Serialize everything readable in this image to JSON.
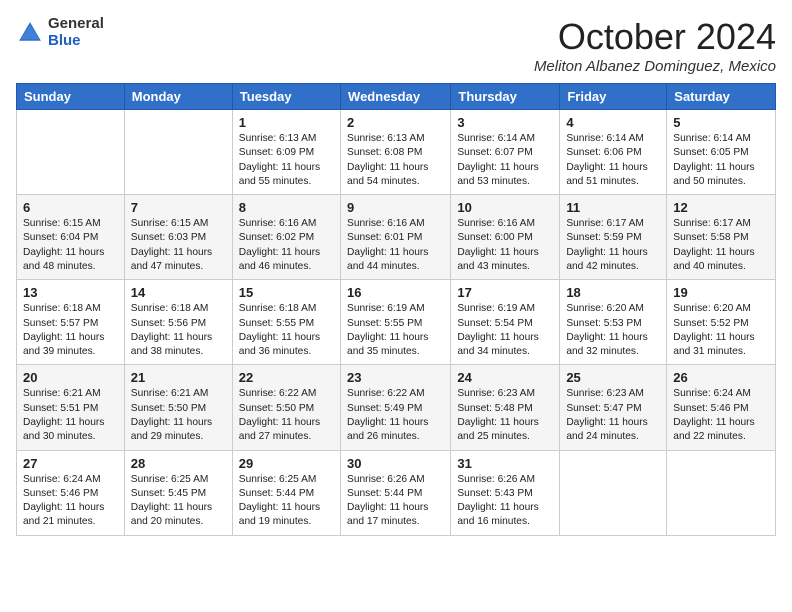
{
  "header": {
    "logo": {
      "general": "General",
      "blue": "Blue"
    },
    "title": "October 2024",
    "location": "Meliton Albanez Dominguez, Mexico"
  },
  "days_of_week": [
    "Sunday",
    "Monday",
    "Tuesday",
    "Wednesday",
    "Thursday",
    "Friday",
    "Saturday"
  ],
  "weeks": [
    [
      null,
      null,
      {
        "day": 1,
        "sunrise": "Sunrise: 6:13 AM",
        "sunset": "Sunset: 6:09 PM",
        "daylight": "Daylight: 11 hours and 55 minutes."
      },
      {
        "day": 2,
        "sunrise": "Sunrise: 6:13 AM",
        "sunset": "Sunset: 6:08 PM",
        "daylight": "Daylight: 11 hours and 54 minutes."
      },
      {
        "day": 3,
        "sunrise": "Sunrise: 6:14 AM",
        "sunset": "Sunset: 6:07 PM",
        "daylight": "Daylight: 11 hours and 53 minutes."
      },
      {
        "day": 4,
        "sunrise": "Sunrise: 6:14 AM",
        "sunset": "Sunset: 6:06 PM",
        "daylight": "Daylight: 11 hours and 51 minutes."
      },
      {
        "day": 5,
        "sunrise": "Sunrise: 6:14 AM",
        "sunset": "Sunset: 6:05 PM",
        "daylight": "Daylight: 11 hours and 50 minutes."
      }
    ],
    [
      {
        "day": 6,
        "sunrise": "Sunrise: 6:15 AM",
        "sunset": "Sunset: 6:04 PM",
        "daylight": "Daylight: 11 hours and 48 minutes."
      },
      {
        "day": 7,
        "sunrise": "Sunrise: 6:15 AM",
        "sunset": "Sunset: 6:03 PM",
        "daylight": "Daylight: 11 hours and 47 minutes."
      },
      {
        "day": 8,
        "sunrise": "Sunrise: 6:16 AM",
        "sunset": "Sunset: 6:02 PM",
        "daylight": "Daylight: 11 hours and 46 minutes."
      },
      {
        "day": 9,
        "sunrise": "Sunrise: 6:16 AM",
        "sunset": "Sunset: 6:01 PM",
        "daylight": "Daylight: 11 hours and 44 minutes."
      },
      {
        "day": 10,
        "sunrise": "Sunrise: 6:16 AM",
        "sunset": "Sunset: 6:00 PM",
        "daylight": "Daylight: 11 hours and 43 minutes."
      },
      {
        "day": 11,
        "sunrise": "Sunrise: 6:17 AM",
        "sunset": "Sunset: 5:59 PM",
        "daylight": "Daylight: 11 hours and 42 minutes."
      },
      {
        "day": 12,
        "sunrise": "Sunrise: 6:17 AM",
        "sunset": "Sunset: 5:58 PM",
        "daylight": "Daylight: 11 hours and 40 minutes."
      }
    ],
    [
      {
        "day": 13,
        "sunrise": "Sunrise: 6:18 AM",
        "sunset": "Sunset: 5:57 PM",
        "daylight": "Daylight: 11 hours and 39 minutes."
      },
      {
        "day": 14,
        "sunrise": "Sunrise: 6:18 AM",
        "sunset": "Sunset: 5:56 PM",
        "daylight": "Daylight: 11 hours and 38 minutes."
      },
      {
        "day": 15,
        "sunrise": "Sunrise: 6:18 AM",
        "sunset": "Sunset: 5:55 PM",
        "daylight": "Daylight: 11 hours and 36 minutes."
      },
      {
        "day": 16,
        "sunrise": "Sunrise: 6:19 AM",
        "sunset": "Sunset: 5:55 PM",
        "daylight": "Daylight: 11 hours and 35 minutes."
      },
      {
        "day": 17,
        "sunrise": "Sunrise: 6:19 AM",
        "sunset": "Sunset: 5:54 PM",
        "daylight": "Daylight: 11 hours and 34 minutes."
      },
      {
        "day": 18,
        "sunrise": "Sunrise: 6:20 AM",
        "sunset": "Sunset: 5:53 PM",
        "daylight": "Daylight: 11 hours and 32 minutes."
      },
      {
        "day": 19,
        "sunrise": "Sunrise: 6:20 AM",
        "sunset": "Sunset: 5:52 PM",
        "daylight": "Daylight: 11 hours and 31 minutes."
      }
    ],
    [
      {
        "day": 20,
        "sunrise": "Sunrise: 6:21 AM",
        "sunset": "Sunset: 5:51 PM",
        "daylight": "Daylight: 11 hours and 30 minutes."
      },
      {
        "day": 21,
        "sunrise": "Sunrise: 6:21 AM",
        "sunset": "Sunset: 5:50 PM",
        "daylight": "Daylight: 11 hours and 29 minutes."
      },
      {
        "day": 22,
        "sunrise": "Sunrise: 6:22 AM",
        "sunset": "Sunset: 5:50 PM",
        "daylight": "Daylight: 11 hours and 27 minutes."
      },
      {
        "day": 23,
        "sunrise": "Sunrise: 6:22 AM",
        "sunset": "Sunset: 5:49 PM",
        "daylight": "Daylight: 11 hours and 26 minutes."
      },
      {
        "day": 24,
        "sunrise": "Sunrise: 6:23 AM",
        "sunset": "Sunset: 5:48 PM",
        "daylight": "Daylight: 11 hours and 25 minutes."
      },
      {
        "day": 25,
        "sunrise": "Sunrise: 6:23 AM",
        "sunset": "Sunset: 5:47 PM",
        "daylight": "Daylight: 11 hours and 24 minutes."
      },
      {
        "day": 26,
        "sunrise": "Sunrise: 6:24 AM",
        "sunset": "Sunset: 5:46 PM",
        "daylight": "Daylight: 11 hours and 22 minutes."
      }
    ],
    [
      {
        "day": 27,
        "sunrise": "Sunrise: 6:24 AM",
        "sunset": "Sunset: 5:46 PM",
        "daylight": "Daylight: 11 hours and 21 minutes."
      },
      {
        "day": 28,
        "sunrise": "Sunrise: 6:25 AM",
        "sunset": "Sunset: 5:45 PM",
        "daylight": "Daylight: 11 hours and 20 minutes."
      },
      {
        "day": 29,
        "sunrise": "Sunrise: 6:25 AM",
        "sunset": "Sunset: 5:44 PM",
        "daylight": "Daylight: 11 hours and 19 minutes."
      },
      {
        "day": 30,
        "sunrise": "Sunrise: 6:26 AM",
        "sunset": "Sunset: 5:44 PM",
        "daylight": "Daylight: 11 hours and 17 minutes."
      },
      {
        "day": 31,
        "sunrise": "Sunrise: 6:26 AM",
        "sunset": "Sunset: 5:43 PM",
        "daylight": "Daylight: 11 hours and 16 minutes."
      },
      null,
      null
    ]
  ]
}
